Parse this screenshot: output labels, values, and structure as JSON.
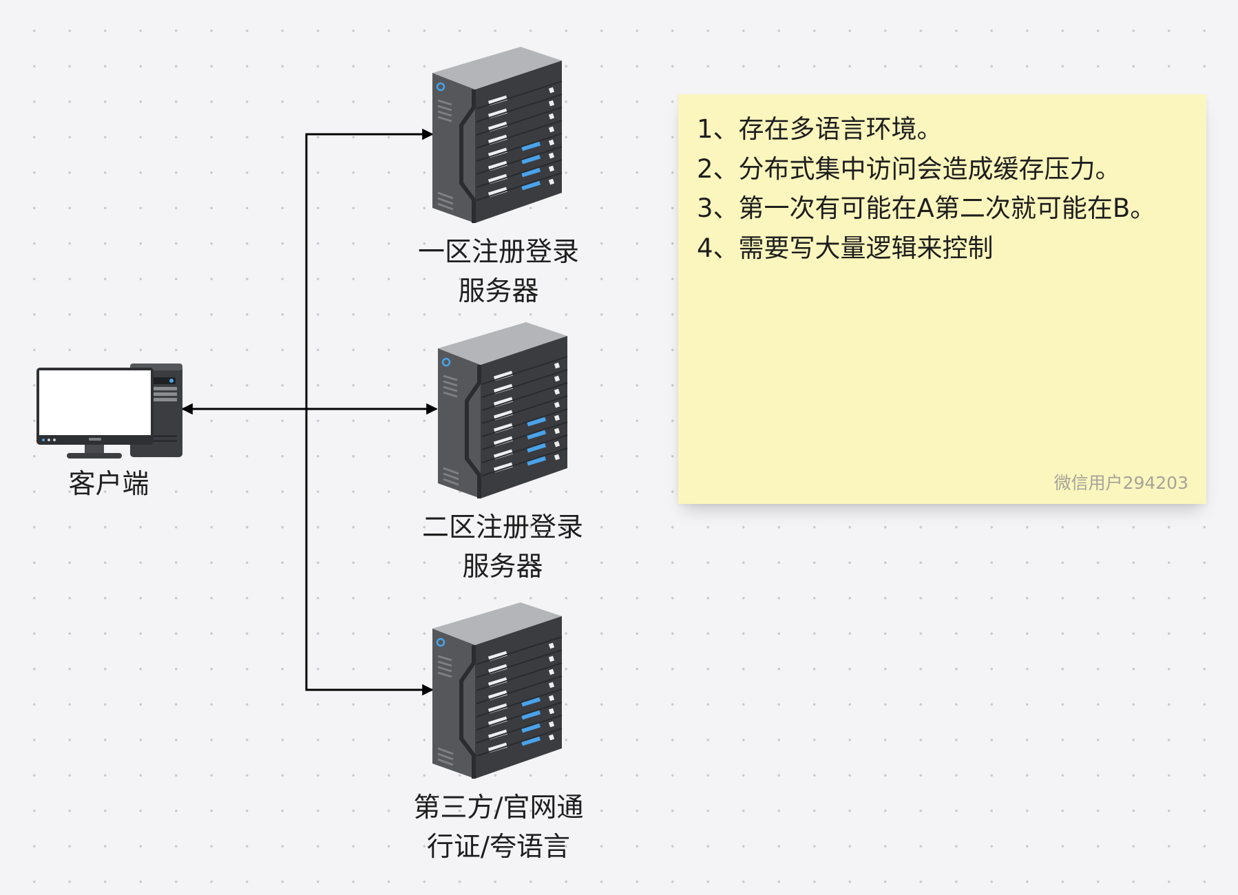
{
  "client": {
    "label": "客户端"
  },
  "servers": [
    {
      "label_lines": [
        "一区注册登录",
        "服务器"
      ]
    },
    {
      "label_lines": [
        "二区注册登录",
        "服务器"
      ]
    },
    {
      "label_lines": [
        "第三方/官网通",
        "行证/夸语言"
      ]
    }
  ],
  "sticky_note": {
    "lines": [
      "1、存在多语言环境。",
      "2、分布式集中访问会造成缓存压力。",
      "3、第一次有可能在A第二次就可能在B。",
      "4、需要写大量逻辑来控制"
    ],
    "author": "微信用户294203",
    "background_color": "#fbf6bd"
  },
  "colors": {
    "connector": "#000000",
    "server_led": "#4aa3ea",
    "canvas_background": "#f4f4f6"
  },
  "icons": {
    "client": "desktop-computer-icon",
    "server": "tower-server-icon"
  }
}
